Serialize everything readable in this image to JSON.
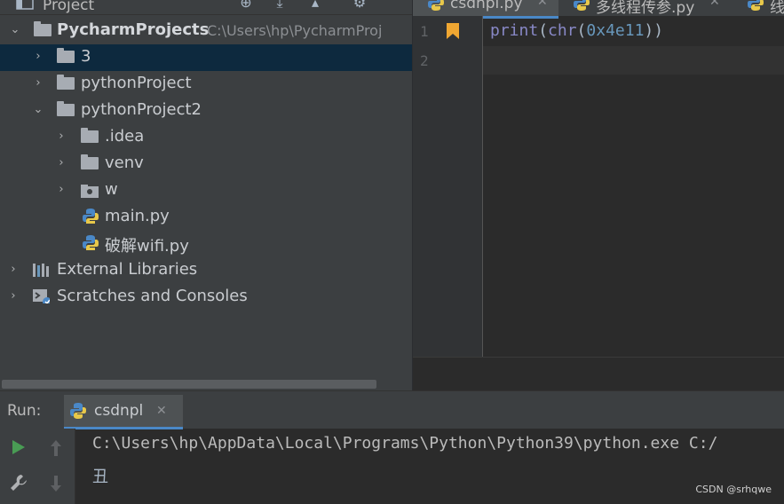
{
  "project_pane": {
    "title": "Project",
    "header_icons": [
      "globe-icon",
      "collapse-all-icon",
      "scroll-up-icon",
      "gear-icon"
    ]
  },
  "tree": [
    {
      "label": "PycharmProjects",
      "path": "C:\\Users\\hp\\PycharmProj",
      "icon": "folder-icon",
      "expanded": true,
      "indent": 0,
      "bold": true
    },
    {
      "label": "3",
      "icon": "folder-icon",
      "expanded": false,
      "indent": 1,
      "selected": true
    },
    {
      "label": "pythonProject",
      "icon": "folder-icon",
      "expanded": false,
      "indent": 1
    },
    {
      "label": "pythonProject2",
      "icon": "folder-icon",
      "expanded": true,
      "indent": 1
    },
    {
      "label": ".idea",
      "icon": "folder-icon",
      "expanded": false,
      "indent": 2
    },
    {
      "label": "venv",
      "icon": "folder-icon",
      "expanded": false,
      "indent": 2
    },
    {
      "label": "w",
      "icon": "module-folder-icon",
      "expanded": false,
      "indent": 2
    },
    {
      "label": "main.py",
      "icon": "python-file-icon",
      "indent": 2
    },
    {
      "label": "破解wifi.py",
      "icon": "python-file-icon",
      "indent": 2
    },
    {
      "label": "External Libraries",
      "icon": "libraries-icon",
      "expanded": false,
      "indent": 0
    },
    {
      "label": "Scratches and Consoles",
      "icon": "scratches-icon",
      "expanded": false,
      "indent": 0
    }
  ],
  "editor": {
    "tabs": [
      {
        "label": "csdnpl.py",
        "active": true
      },
      {
        "label": "多线程传参.py",
        "active": false
      },
      {
        "label": "线",
        "active": false
      }
    ],
    "line_numbers": [
      "1",
      "2"
    ],
    "code": {
      "fn1": "print",
      "p1": "(",
      "fn2": "chr",
      "p2": "(",
      "arg": "0x4e11",
      "p3": "))"
    }
  },
  "run": {
    "title": "Run:",
    "tab_label": "csdnpl",
    "output": [
      "C:\\Users\\hp\\AppData\\Local\\Programs\\Python\\Python39\\python.exe C:/",
      "丑"
    ]
  },
  "watermark": "CSDN @srhqwe",
  "colors": {
    "selection": "#0d293e",
    "accent": "#4a88c7",
    "run_green": "#499c54",
    "bookmark": "#f0a732"
  }
}
